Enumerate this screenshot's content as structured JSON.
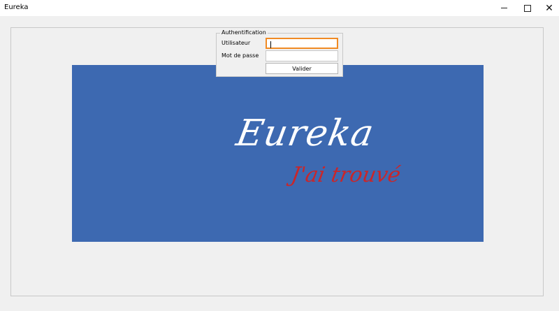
{
  "window": {
    "title": "Eureka",
    "minimize_glyph": "—",
    "maximize_glyph": "□",
    "close_glyph": "✕"
  },
  "banner": {
    "background": "#3d69b1",
    "logo_text": "Eureka",
    "tagline": "J'ai trouvé",
    "logo_color": "#ffffff",
    "tagline_color": "#c9262a"
  },
  "auth": {
    "legend": "Authentification",
    "user_label": "Utilisateur",
    "user_value": "",
    "password_label": "Mot de passe",
    "password_value": "",
    "submit_label": "Valider",
    "focus_color": "#f08a24"
  }
}
